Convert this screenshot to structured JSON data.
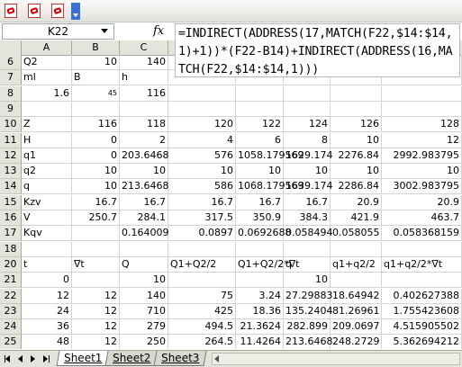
{
  "toolbar": {
    "buttons": [
      "pdf-convert-icon",
      "pdf-export-icon",
      "pdf-settings-icon"
    ]
  },
  "name_box": {
    "value": "K22"
  },
  "formula_bar": {
    "fx": "fx",
    "formula": "=INDIRECT(ADDRESS(17,MATCH(F22,$14:$14,1)+1))*(F22-B14)+INDIRECT(ADDRESS(16,MATCH(F22,$14:$14,1)))"
  },
  "columns": [
    "A",
    "B",
    "C"
  ],
  "rows": [
    {
      "num": "6",
      "cells": [
        [
          "Q2",
          "l"
        ],
        [
          "10",
          "r"
        ],
        [
          "140",
          "r"
        ],
        [
          "",
          "r"
        ],
        [
          "",
          "r"
        ],
        [
          "",
          "r"
        ],
        [
          "",
          "r"
        ],
        [
          "",
          "r"
        ]
      ]
    },
    {
      "num": "7",
      "cells": [
        [
          "ml",
          "l"
        ],
        [
          "B",
          "l"
        ],
        [
          "h",
          "l"
        ],
        [
          "",
          "r"
        ],
        [
          "",
          "r"
        ],
        [
          "",
          "r"
        ],
        [
          "",
          "r"
        ],
        [
          "",
          "r"
        ]
      ]
    },
    {
      "num": "8",
      "cells": [
        [
          "1.6",
          "r"
        ],
        [
          "45",
          "r small"
        ],
        [
          "116",
          "r"
        ],
        [
          "",
          "r"
        ],
        [
          "",
          "r"
        ],
        [
          "",
          "r"
        ],
        [
          "",
          "r"
        ],
        [
          "",
          "r"
        ]
      ]
    },
    {
      "num": "9",
      "cells": [
        [
          "",
          "r"
        ],
        [
          "",
          "r"
        ],
        [
          "",
          "r"
        ],
        [
          "",
          "r"
        ],
        [
          "",
          "r"
        ],
        [
          "",
          "r"
        ],
        [
          "",
          "r"
        ],
        [
          "",
          "r"
        ]
      ]
    },
    {
      "num": "10",
      "cells": [
        [
          "Z",
          "l"
        ],
        [
          "116",
          "r"
        ],
        [
          "118",
          "r"
        ],
        [
          "120",
          "r"
        ],
        [
          "122",
          "r"
        ],
        [
          "124",
          "r"
        ],
        [
          "126",
          "r"
        ],
        [
          "128",
          "r"
        ]
      ]
    },
    {
      "num": "11",
      "cells": [
        [
          "H",
          "l"
        ],
        [
          "0",
          "r"
        ],
        [
          "2",
          "r"
        ],
        [
          "4",
          "r"
        ],
        [
          "6",
          "r"
        ],
        [
          "8",
          "r"
        ],
        [
          "10",
          "r"
        ],
        [
          "12",
          "r"
        ]
      ]
    },
    {
      "num": "12",
      "cells": [
        [
          "q1",
          "l"
        ],
        [
          "0",
          "r"
        ],
        [
          "203.6468",
          "r"
        ],
        [
          "576",
          "r"
        ],
        [
          "1058.179569",
          "r"
        ],
        [
          "1629.174",
          "r"
        ],
        [
          "2276.84",
          "r"
        ],
        [
          "2992.983795",
          "r"
        ]
      ]
    },
    {
      "num": "13",
      "cells": [
        [
          "q2",
          "l"
        ],
        [
          "10",
          "r"
        ],
        [
          "10",
          "r"
        ],
        [
          "10",
          "r"
        ],
        [
          "10",
          "r"
        ],
        [
          "10",
          "r"
        ],
        [
          "10",
          "r"
        ],
        [
          "10",
          "r"
        ]
      ]
    },
    {
      "num": "14",
      "cells": [
        [
          "q",
          "l"
        ],
        [
          "10",
          "r"
        ],
        [
          "213.6468",
          "r"
        ],
        [
          "586",
          "r"
        ],
        [
          "1068.179569",
          "r"
        ],
        [
          "1639.174",
          "r"
        ],
        [
          "2286.84",
          "r"
        ],
        [
          "3002.983795",
          "r"
        ]
      ]
    },
    {
      "num": "15",
      "cells": [
        [
          "Kzv",
          "l"
        ],
        [
          "16.7",
          "r"
        ],
        [
          "16.7",
          "r"
        ],
        [
          "16.7",
          "r"
        ],
        [
          "16.7",
          "r"
        ],
        [
          "16.7",
          "r"
        ],
        [
          "20.9",
          "r"
        ],
        [
          "20.9",
          "r"
        ]
      ]
    },
    {
      "num": "16",
      "cells": [
        [
          "V",
          "l"
        ],
        [
          "250.7",
          "r"
        ],
        [
          "284.1",
          "r"
        ],
        [
          "317.5",
          "r"
        ],
        [
          "350.9",
          "r"
        ],
        [
          "384.3",
          "r"
        ],
        [
          "421.9",
          "r"
        ],
        [
          "463.7",
          "r"
        ]
      ]
    },
    {
      "num": "17",
      "cells": [
        [
          "Kqv",
          "l"
        ],
        [
          "",
          "r"
        ],
        [
          "0.164009",
          "r"
        ],
        [
          "0.0897",
          "r"
        ],
        [
          "0.0692688",
          "r"
        ],
        [
          "0.058494",
          "r"
        ],
        [
          "0.058055",
          "r"
        ],
        [
          "0.058368159",
          "r"
        ]
      ]
    },
    {
      "num": "18",
      "cells": [
        [
          "",
          "r"
        ],
        [
          "",
          "r"
        ],
        [
          "",
          "r"
        ],
        [
          "",
          "r"
        ],
        [
          "",
          "r"
        ],
        [
          "",
          "r"
        ],
        [
          "",
          "r"
        ],
        [
          "",
          "r"
        ]
      ]
    },
    {
      "num": "20",
      "cells": [
        [
          "t",
          "l"
        ],
        [
          "∇t",
          "l"
        ],
        [
          "Q",
          "l"
        ],
        [
          "Q1+Q2/2",
          "l"
        ],
        [
          "Q1+Q2/2*∇t",
          "l"
        ],
        [
          "q",
          "l"
        ],
        [
          "q1+q2/2",
          "l"
        ],
        [
          "q1+q2/2*∇t",
          "l"
        ]
      ]
    },
    {
      "num": "21",
      "cells": [
        [
          "0",
          "r"
        ],
        [
          "",
          "r"
        ],
        [
          "10",
          "r"
        ],
        [
          "",
          "r"
        ],
        [
          "",
          "r"
        ],
        [
          "10",
          "r"
        ],
        [
          "",
          "r"
        ],
        [
          "",
          "r"
        ]
      ]
    },
    {
      "num": "22",
      "cells": [
        [
          "12",
          "r"
        ],
        [
          "12",
          "r"
        ],
        [
          "140",
          "r"
        ],
        [
          "75",
          "r"
        ],
        [
          "3.24",
          "r"
        ],
        [
          "27.29883",
          "r"
        ],
        [
          "18.64942",
          "r"
        ],
        [
          "0.402627388",
          "r"
        ]
      ]
    },
    {
      "num": "23",
      "cells": [
        [
          "24",
          "r"
        ],
        [
          "12",
          "r"
        ],
        [
          "710",
          "r"
        ],
        [
          "425",
          "r"
        ],
        [
          "18.36",
          "r"
        ],
        [
          "135.2404",
          "r"
        ],
        [
          "81.26961",
          "r"
        ],
        [
          "1.755423608",
          "r"
        ]
      ]
    },
    {
      "num": "24",
      "cells": [
        [
          "36",
          "r"
        ],
        [
          "12",
          "r"
        ],
        [
          "279",
          "r"
        ],
        [
          "494.5",
          "r"
        ],
        [
          "21.3624",
          "r"
        ],
        [
          "282.899",
          "r"
        ],
        [
          "209.0697",
          "r"
        ],
        [
          "4.515905502",
          "r"
        ]
      ]
    },
    {
      "num": "25",
      "cells": [
        [
          "48",
          "r"
        ],
        [
          "12",
          "r"
        ],
        [
          "250",
          "r"
        ],
        [
          "264.5",
          "r"
        ],
        [
          "11.4264",
          "r"
        ],
        [
          "213.6468",
          "r"
        ],
        [
          "248.2729",
          "r"
        ],
        [
          "5.362694212",
          "r"
        ]
      ]
    },
    {
      "num": "26",
      "cells": [
        [
          "48",
          "r"
        ],
        [
          "0",
          "r"
        ],
        [
          "131",
          "r"
        ],
        [
          "190.5",
          "r"
        ],
        [
          "8.2296",
          "r"
        ],
        [
          "2458",
          "r"
        ],
        [
          "1335.823",
          "r"
        ],
        [
          "0",
          "r"
        ]
      ]
    }
  ],
  "sheet_tabs": [
    "Sheet1",
    "Sheet2",
    "Sheet3"
  ],
  "active_tab": "Sheet1"
}
